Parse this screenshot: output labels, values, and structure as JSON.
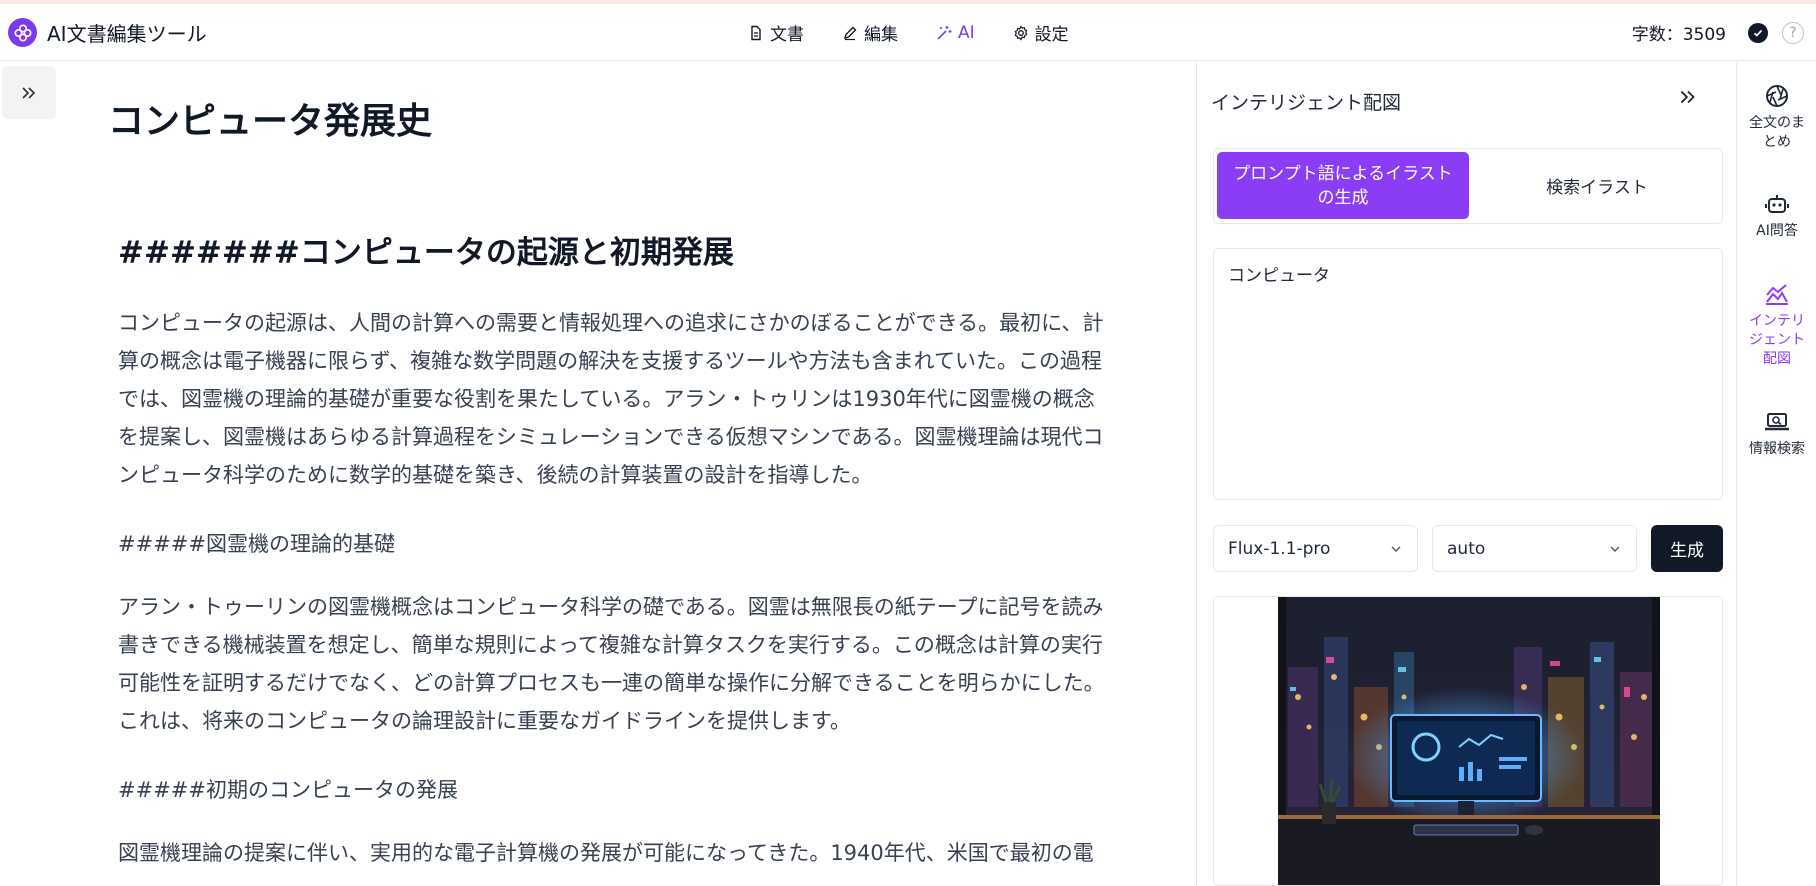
{
  "app": {
    "title": "AI文書編集ツール"
  },
  "nav": [
    {
      "label": "文書",
      "icon": "document-icon"
    },
    {
      "label": "編集",
      "icon": "pencil-icon"
    },
    {
      "label": "AI",
      "icon": "magic-wand-icon",
      "active": true
    },
    {
      "label": "設定",
      "icon": "gear-icon"
    }
  ],
  "header": {
    "wordcount": "字数：3509",
    "help": "?"
  },
  "document": {
    "title": "コンピュータ発展史",
    "heading1": "#######コンピュータの起源と初期発展",
    "para1": [
      "コンピュータの起源は、人間の計算への需要と情報処理への追求にさかのぼることができる。最初に、計",
      "算の概念は電子機器に限らず、複雑な数学問題の解決を支援するツールや方法も含まれていた。この過程",
      "では、図霊機の理論的基礎が重要な役割を果たしている。アラン・トゥリンは1930年代に図霊機の概念",
      "を提案し、図霊機はあらゆる計算過程をシミュレーションできる仮想マシンである。図霊機理論は現代コ",
      "ンピュータ科学のために数学的基礎を築き、後続の計算装置の設計を指導した。"
    ],
    "subhead1": "#####図霊機の理論的基礎",
    "para2": [
      "アラン・トゥーリンの図霊機概念はコンピュータ科学の礎である。図霊は無限長の紙テープに記号を読み",
      "書きできる機械装置を想定し、簡単な規則によって複雑な計算タスクを実行する。この概念は計算の実行",
      "可能性を証明するだけでなく、どの計算プロセスも一連の簡単な操作に分解できることを明らかにした。",
      "これは、将来のコンピュータの論理設計に重要なガイドラインを提供します。"
    ],
    "subhead2": "#####初期のコンピュータの発展",
    "para3": [
      "図霊機理論の提案に伴い、実用的な電子計算機の発展が可能になってきた。1940年代、米国で最初の電"
    ]
  },
  "panel": {
    "title": "インテリジェント配図",
    "tab_prompt": "プロンプト語によるイラストの生成",
    "tab_search": "検索イラスト",
    "prompt_value": "コンピュータ",
    "model_select": "Flux-1.1-pro",
    "size_select": "auto",
    "generate_label": "生成"
  },
  "rail": [
    {
      "label": "全文のまとめ",
      "icon": "aperture-icon"
    },
    {
      "label": "AI問答",
      "icon": "robot-icon"
    },
    {
      "label": "インテリジェント配図",
      "icon": "image-chart-icon",
      "active": true
    },
    {
      "label": "情報検索",
      "icon": "laptop-search-icon"
    }
  ],
  "colors": {
    "accent": "#8b3cf5",
    "dark": "#111827"
  }
}
